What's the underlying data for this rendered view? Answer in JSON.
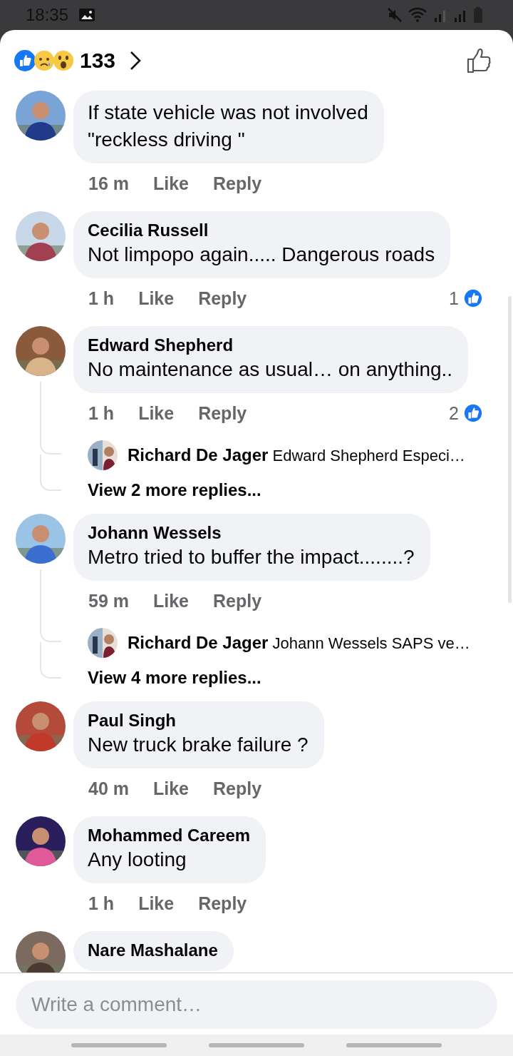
{
  "status_bar": {
    "time": "18:35"
  },
  "reactions": {
    "count": "133"
  },
  "comments": [
    {
      "text": "If state vehicle was not involved\n\"reckless driving \"",
      "time": "16 m",
      "like": "Like",
      "reply": "Reply"
    },
    {
      "author": "Cecilia Russell",
      "text": "Not limpopo again..... Dangerous roads",
      "time": "1 h",
      "like": "Like",
      "reply": "Reply",
      "reaction_count": "1"
    },
    {
      "author": "Edward Shepherd",
      "text": "No maintenance as usual… on anything..",
      "time": "1 h",
      "like": "Like",
      "reply": "Reply",
      "reaction_count": "2",
      "replies": [
        {
          "author": "Richard De Jager",
          "text": "Edward Shepherd Especi…"
        }
      ],
      "view_more": "View 2 more replies..."
    },
    {
      "author": "Johann Wessels",
      "text": "Metro tried to buffer the impact........?",
      "time": "59 m",
      "like": "Like",
      "reply": "Reply",
      "replies": [
        {
          "author": "Richard De Jager",
          "text": "Johann Wessels SAPS ve…"
        }
      ],
      "view_more": "View 4 more replies..."
    },
    {
      "author": "Paul Singh",
      "text": "New truck brake failure  ?",
      "time": "40 m",
      "like": "Like",
      "reply": "Reply"
    },
    {
      "author": "Mohammed Careem",
      "text": "Any looting",
      "time": "1 h",
      "like": "Like",
      "reply": "Reply"
    },
    {
      "author": "Nare Mashalane"
    }
  ],
  "composer": {
    "placeholder": "Write a comment…"
  }
}
